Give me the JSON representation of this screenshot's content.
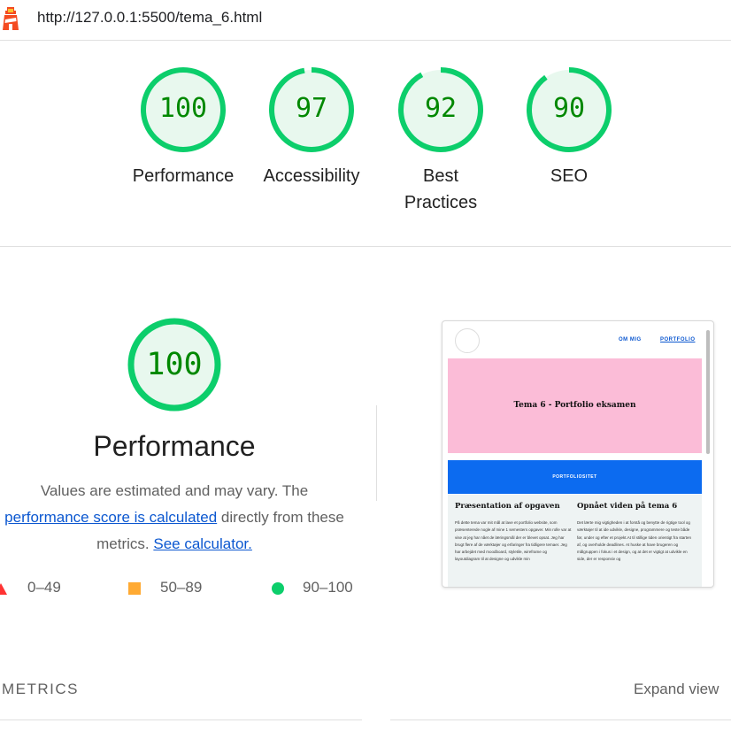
{
  "url_bar": {
    "url": "http://127.0.0.1:5500/tema_6.html",
    "logo_icon": "lighthouse-icon"
  },
  "colors": {
    "pass": "#0cce6b",
    "pass_text": "#008800",
    "pass_fill": "#e8f8ee",
    "average": "#ffaa33",
    "fail": "#ff3333",
    "link": "#0b57d0"
  },
  "gauges": [
    {
      "score": "100",
      "label": "Performance",
      "fraction": 1.0
    },
    {
      "score": "97",
      "label": "Accessibility",
      "fraction": 0.97
    },
    {
      "score": "92",
      "label": "Best Practices",
      "label_line1": "Best",
      "label_line2": "Practices",
      "fraction": 0.92
    },
    {
      "score": "90",
      "label": "SEO",
      "fraction": 0.9
    }
  ],
  "performance": {
    "score": "100",
    "fraction": 1.0,
    "title": "Performance",
    "desc_part1": "Values are estimated and may vary. The",
    "desc_link": "performance score is calculated",
    "desc_part2": "directly from these metrics.",
    "calc_link": "See calculator."
  },
  "legend": {
    "fail": "0–49",
    "average": "50–89",
    "pass": "90–100"
  },
  "screenshot": {
    "nav_about": "OM MIG",
    "nav_portfolio": "PORTFOLIO",
    "hero_title": "Tema 6 - Portfolio eksamen",
    "band_text": "PORTFOLIOSITET",
    "left_heading": "Præsentation af opgaven",
    "right_heading": "Opnået viden på tema 6",
    "left_text": "På dette tema var mit mål at lave et portfolio website, som præsenterede nogle af mine 1 semesters opgaver. Min rolle var at vise at jeg har nået de læringsmål der er blevet opsat. Jeg har brugt flere af de værktøjer og erfaringer fra tidligere temaer. Jeg har arbejdet med moodboard, styletile, wireframe og layoutdiagram til at designe og udvikle min",
    "right_text": "Det lærte mig vigtigheden i at forstå og benytte de rigtige tool og værktøjer til at ide udvikle, designe, programmere og teste både før, under og efter et projekt.At til stillige tiden orientigt fra starten af, og overholde deadlines. At huske at have brugeren og målgruppen i fokus i et design, og at det er vigtigt at udvikle en side, der er responsiv og"
  },
  "footer": {
    "metrics": "METRICS",
    "expand": "Expand view"
  }
}
